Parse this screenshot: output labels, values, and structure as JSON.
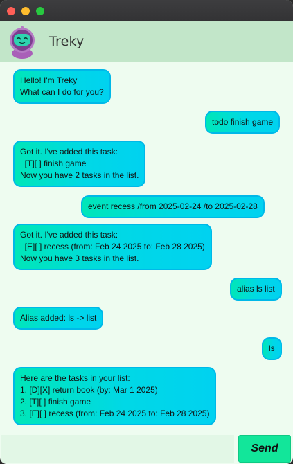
{
  "header": {
    "bot_name": "Treky"
  },
  "messages": [
    {
      "from": "bot",
      "text": "Hello! I'm Treky\nWhat can I do for you?"
    },
    {
      "from": "user",
      "text": "todo finish game"
    },
    {
      "from": "bot",
      "text": "Got it. I've added this task:\n  [T][ ] finish game\nNow you have 2 tasks in the list."
    },
    {
      "from": "user",
      "text": "event recess /from 2025-02-24 /to 2025-02-28"
    },
    {
      "from": "bot",
      "text": "Got it. I've added this task:\n  [E][ ] recess (from: Feb 24 2025 to: Feb 28 2025)\nNow you have 3 tasks in the list."
    },
    {
      "from": "user",
      "text": "alias ls list"
    },
    {
      "from": "bot",
      "text": "Alias added: ls -> list"
    },
    {
      "from": "user",
      "text": "ls"
    },
    {
      "from": "bot",
      "text": "Here are the tasks in your list:\n1. [D][X] return book (by: Mar 1 2025)\n2. [T][ ] finish game\n3. [E][ ] recess (from: Feb 24 2025 to: Feb 28 2025)"
    }
  ],
  "input": {
    "value": "",
    "placeholder": ""
  },
  "send_label": "Send",
  "colors": {
    "header_bg": "#c2e6c9",
    "chat_bg": "#eefcf0",
    "bubble_start": "#00e6b8",
    "bubble_end": "#00d2f0",
    "send_bg": "#12e69a"
  }
}
